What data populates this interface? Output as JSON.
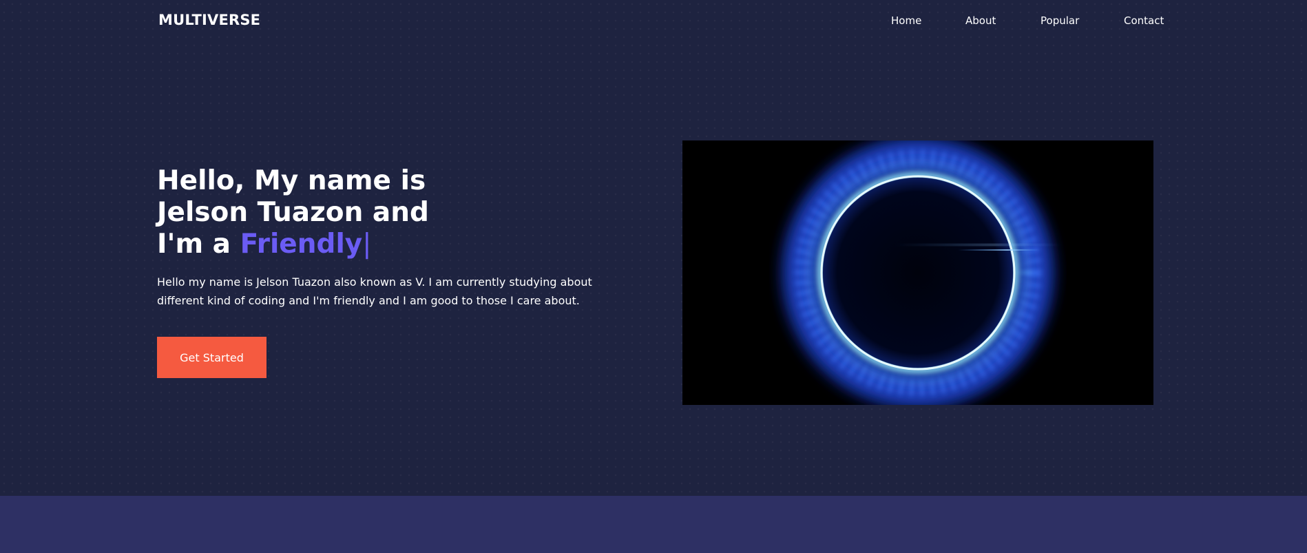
{
  "header": {
    "logo": "MULTIVERSE",
    "nav": [
      {
        "label": "Home"
      },
      {
        "label": "About"
      },
      {
        "label": "Popular"
      },
      {
        "label": "Contact"
      }
    ]
  },
  "hero": {
    "headline_line1": "Hello, My name is",
    "headline_line2": "Jelson Tuazon and",
    "headline_prefix": "I'm a ",
    "headline_accent": "Friendly",
    "typing_cursor": "|",
    "intro_line1": "Hello my name is Jelson Tuazon also known as V. I am currently studying about",
    "intro_line2": "different kind of coding and I'm friendly and I am good to those I care about.",
    "cta_label": "Get Started",
    "image_icon": "blue-eclipse-ring"
  },
  "colors": {
    "background": "#1e2340",
    "lower_section": "#2e3064",
    "accent": "#6b5cf4",
    "cta": "#f55a40",
    "text": "#ffffff"
  }
}
